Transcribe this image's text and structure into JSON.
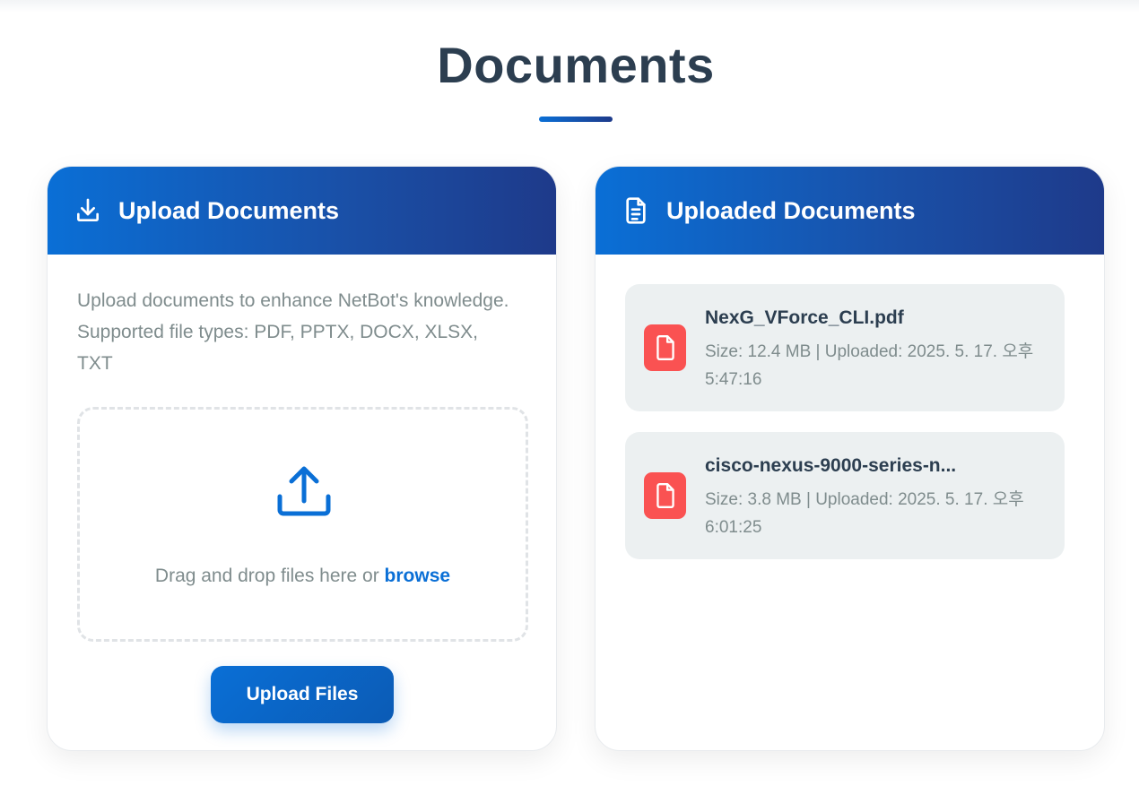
{
  "page": {
    "title": "Documents"
  },
  "upload_card": {
    "title": "Upload Documents",
    "icon": "download-icon",
    "description": "Upload documents to enhance NetBot's knowledge. Supported file types: PDF, PPTX, DOCX, XLSX, TXT",
    "dropzone": {
      "icon": "upload-icon",
      "text": "Drag and drop files here or ",
      "browse_label": "browse"
    },
    "upload_button": "Upload Files"
  },
  "documents_card": {
    "title": "Uploaded Documents",
    "icon": "document-icon",
    "documents": [
      {
        "name": "NexG_VForce_CLI.pdf",
        "meta": "Size: 12.4 MB | Uploaded: 2025. 5. 17. 오후 5:47:16",
        "icon": "file-icon"
      },
      {
        "name": "cisco-nexus-9000-series-n...",
        "meta": "Size: 3.8 MB | Uploaded: 2025. 5. 17. 오후 6:01:25",
        "icon": "file-icon"
      }
    ]
  },
  "colors": {
    "accent": "#0a6fd6",
    "header_end": "#1e3a8a",
    "file_icon": "#fa5252",
    "text_dark": "#2c3e50",
    "text_muted": "#7f8c8d",
    "item_bg": "#ecf0f1"
  }
}
